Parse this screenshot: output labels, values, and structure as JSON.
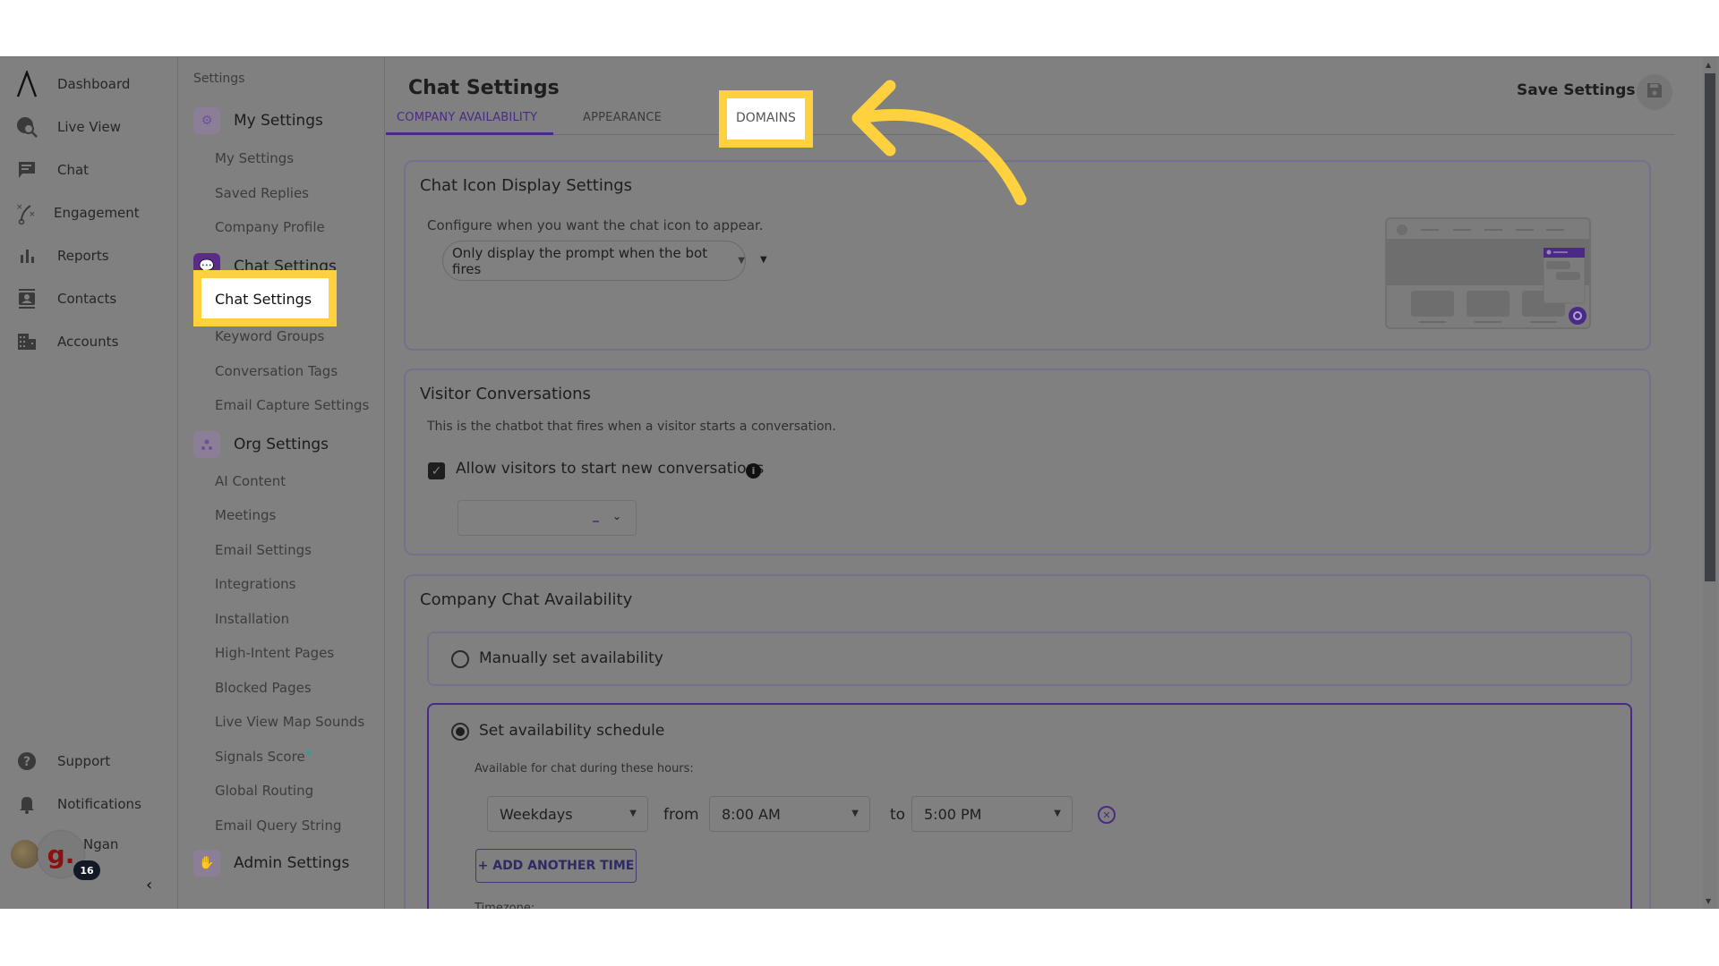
{
  "leftnav": {
    "items": [
      {
        "label": "Dashboard",
        "icon": "logo-icon"
      },
      {
        "label": "Live View",
        "icon": "live-view-icon"
      },
      {
        "label": "Chat",
        "icon": "chat-icon"
      },
      {
        "label": "Engagement",
        "icon": "engagement-icon"
      },
      {
        "label": "Reports",
        "icon": "reports-icon"
      },
      {
        "label": "Contacts",
        "icon": "contacts-icon"
      },
      {
        "label": "Accounts",
        "icon": "accounts-icon"
      }
    ],
    "bottom": [
      {
        "label": "Support",
        "icon": "help-icon"
      },
      {
        "label": "Notifications",
        "icon": "bell-icon"
      }
    ],
    "user": {
      "name": "Ngan",
      "initial": "g.",
      "badge": "16"
    },
    "collapse_glyph": "‹"
  },
  "settings_nav": {
    "heading": "Settings",
    "groups": [
      {
        "label": "My Settings",
        "items": [
          "My Settings",
          "Saved Replies",
          "Company Profile"
        ]
      },
      {
        "label": "Chat Settings",
        "items": [
          "Chat Settings",
          "Keyword Groups",
          "Conversation Tags",
          "Email Capture Settings"
        ]
      },
      {
        "label": "Org Settings",
        "items": [
          "AI Content",
          "Meetings",
          "Email Settings",
          "Integrations",
          "Installation",
          "High-Intent Pages",
          "Blocked Pages",
          "Live View Map Sounds",
          "Signals Score",
          "Global Routing",
          "Email Query String"
        ]
      },
      {
        "label": "Admin Settings",
        "items": []
      }
    ],
    "signals_badge": "✦",
    "highlighted_item": "Chat Settings"
  },
  "header": {
    "title": "Chat Settings",
    "tabs": [
      {
        "label": "COMPANY AVAILABILITY",
        "active": true
      },
      {
        "label": "APPEARANCE",
        "active": false
      },
      {
        "label": "DOMAINS",
        "active": false,
        "highlighted": true
      }
    ],
    "save_label": "Save Settings"
  },
  "chat_icon_display": {
    "title": "Chat Icon Display Settings",
    "description": "Configure when you want the chat icon to appear.",
    "selected": "Only display the prompt when the bot fires"
  },
  "visitor_conversations": {
    "title": "Visitor Conversations",
    "description": "This is the chatbot that fires when a visitor starts a conversation.",
    "allow_label": "Allow visitors to start new conversations",
    "allow_checked": true,
    "bot_select_value": ""
  },
  "company_availability": {
    "title": "Company Chat Availability",
    "manual_label": "Manually set availability",
    "schedule_label": "Set availability schedule",
    "selected_mode": "schedule",
    "hours_label": "Available for chat during these hours:",
    "schedule": [
      {
        "days": "Weekdays",
        "from_label": "from",
        "start": "8:00 AM",
        "to_label": "to",
        "end": "5:00 PM"
      }
    ],
    "add_time_label": "+ ADD ANOTHER TIME",
    "timezone_label": "Timezone:"
  },
  "colors": {
    "accent": "#4b2a87",
    "highlight": "#ffd13f",
    "overlay_bg": "#808080"
  }
}
